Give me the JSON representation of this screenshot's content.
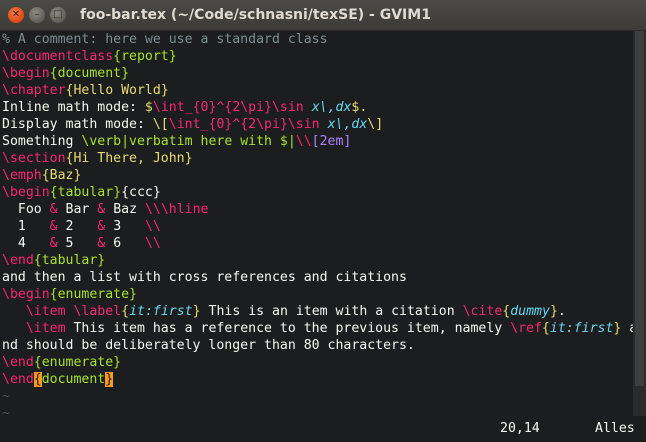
{
  "window": {
    "title": "foo-bar.tex (~/Code/schnasni/texSE) - GVIM1"
  },
  "tokens": {
    "comment": "% A comment: here we use a standard class",
    "documentclass": "\\documentclass",
    "report": "{report}",
    "begin": "\\begin",
    "document_arg": "{document}",
    "chapter": "\\chapter",
    "chapter_arg": "{Hello World}",
    "inline_label": "Inline math mode: ",
    "dollar": "$",
    "dollar_dot": "$.",
    "int": "\\int",
    "sub0": "_{0}",
    "sup2pi": "^{2\\pi}",
    "sin": "\\sin",
    "xdx": " x\\,dx",
    "display_label": "Display math mode: ",
    "disp_open": "\\[",
    "disp_close": "\\]",
    "something": "Something ",
    "verb": "\\verb|verbatim here with $|",
    "dbl": "\\\\",
    "twoem": "[2em]",
    "section": "\\section",
    "section_arg": "{Hi There, John}",
    "emph": "\\emph",
    "emph_arg": "{Baz}",
    "tabular_arg": "{tabular}",
    "ccc": "{ccc}",
    "row1_a": "  Foo ",
    "amp": "&",
    "row1_b": " Bar ",
    "row1_c": " Baz ",
    "hline": "\\hline",
    "row2_a": "  1   ",
    "row2_b": " 2   ",
    "row2_c": " 3   ",
    "row3_a": "  4   ",
    "row3_b": " 5   ",
    "row3_c": " 6   ",
    "end": "\\end",
    "and_then": "and then a list with cross references and citations",
    "enumerate_arg": "{enumerate}",
    "indent": "   ",
    "item": "\\item",
    "label": "\\label",
    "ob": "{",
    "cb": "}",
    "itfirst": "it:first",
    "item1_text": " This is an item with a citation ",
    "cite": "\\cite",
    "dummy": "dummy",
    "dot": ".",
    "item2_text": " This item has a reference to the previous item, namely ",
    "ref": "\\ref",
    "a": " a",
    "wrap": "nd should be deliberately longer than 80 characters.",
    "doc_word": "document",
    "tilde": "~"
  },
  "status": {
    "position": "20,14",
    "scroll": "Alles"
  }
}
